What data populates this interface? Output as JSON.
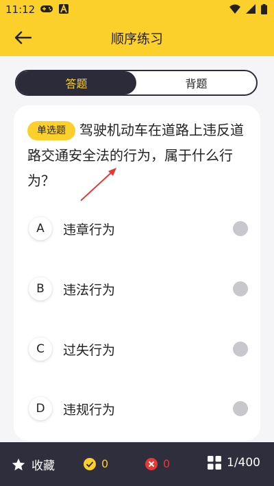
{
  "status": {
    "time": "11:12"
  },
  "header": {
    "title": "顺序练习"
  },
  "tabs": [
    {
      "label": "答题"
    },
    {
      "label": "背题"
    }
  ],
  "question": {
    "badge": "单选题",
    "text": "驾驶机动车在道路上违反道路交通安全法的行为，属于什么行为？"
  },
  "options": [
    {
      "letter": "A",
      "text": "违章行为"
    },
    {
      "letter": "B",
      "text": "违法行为"
    },
    {
      "letter": "C",
      "text": "过失行为"
    },
    {
      "letter": "D",
      "text": "违规行为"
    }
  ],
  "bottom": {
    "favorite_label": "收藏",
    "correct_count": "0",
    "wrong_count": "0",
    "progress": "1/400"
  },
  "colors": {
    "accent": "#fcd02b",
    "dark": "#2e2e3c",
    "wrong": "#e53935"
  }
}
